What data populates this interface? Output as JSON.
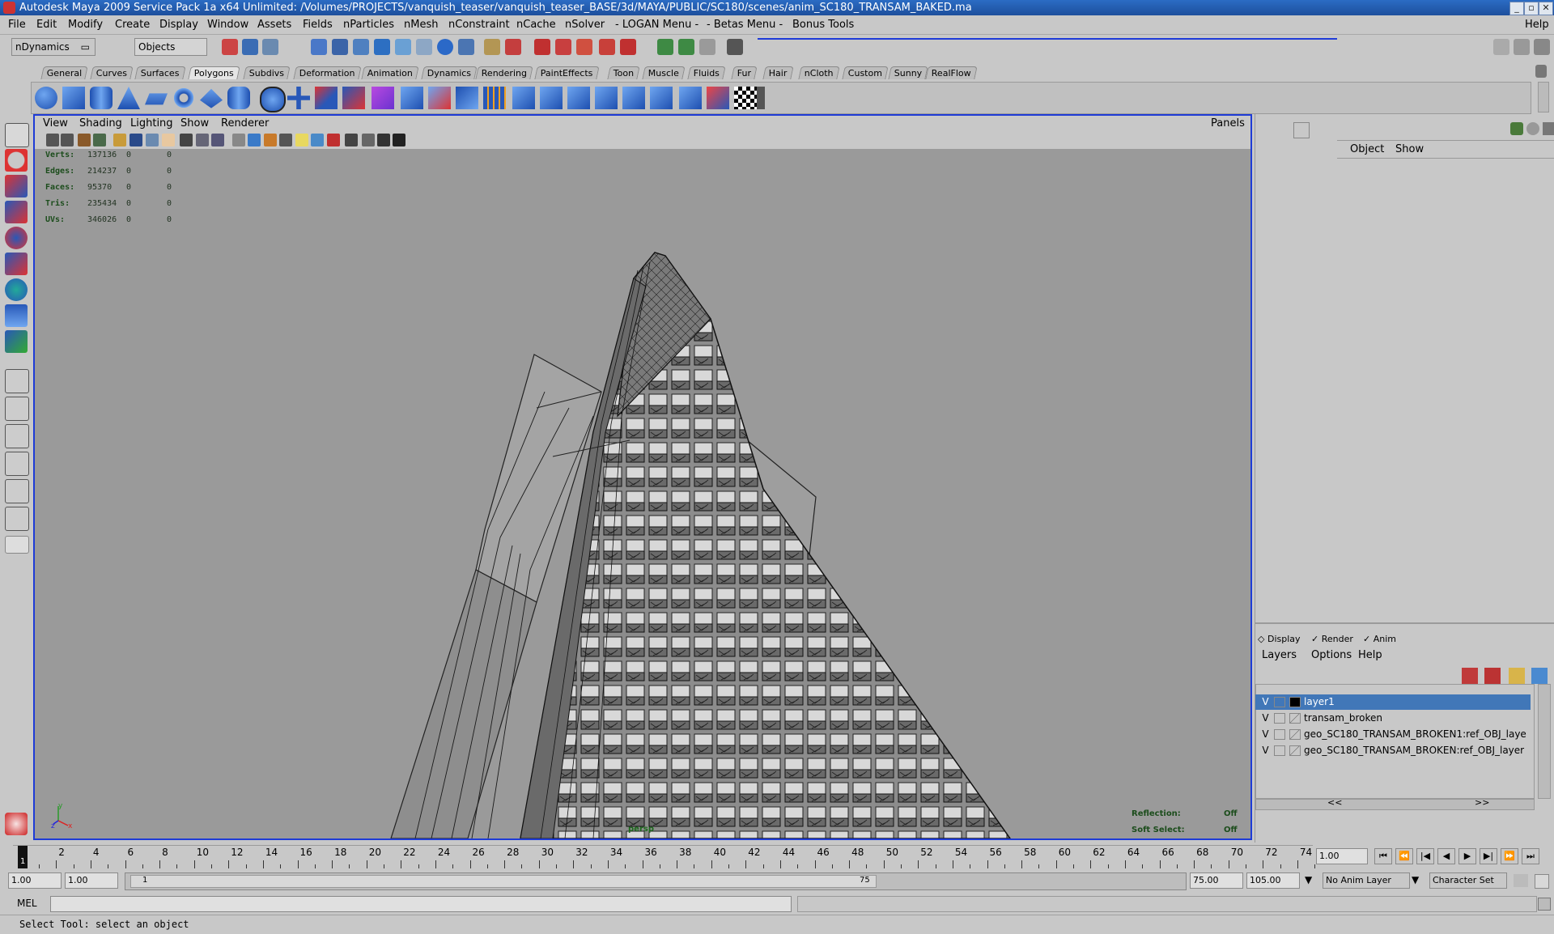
{
  "window": {
    "title": "Autodesk Maya 2009 Service Pack 1a x64 Unlimited: /Volumes/PROJECTS/vanquish_teaser/vanquish_teaser_BASE/3d/MAYA/PUBLIC/SC180/scenes/anim_SC180_TRANSAM_BAKED.ma"
  },
  "menubar": {
    "items": [
      "File",
      "Edit",
      "Modify",
      "Create",
      "Display",
      "Window",
      "Assets",
      "Fields",
      "nParticles",
      "nMesh",
      "nConstraint",
      "nCache",
      "nSolver",
      "- LOGAN Menu -",
      "- Betas Menu -",
      "Bonus Tools"
    ],
    "help": "Help"
  },
  "statusline": {
    "menuset": "nDynamics",
    "selection_mode": "Objects"
  },
  "shelf": {
    "tabs": [
      "General",
      "Curves",
      "Surfaces",
      "Polygons",
      "Subdivs",
      "Deformation",
      "Animation",
      "Dynamics",
      "Rendering",
      "PaintEffects",
      "Toon",
      "Muscle",
      "Fluids",
      "Fur",
      "Hair",
      "nCloth",
      "Custom",
      "Sunny",
      "RealFlow"
    ],
    "active_tab": "Polygons"
  },
  "viewport": {
    "menu": [
      "View",
      "Shading",
      "Lighting",
      "Show",
      "Renderer"
    ],
    "panels": "Panels",
    "camera": "persp",
    "hud": {
      "rows": [
        {
          "label": "Verts:",
          "v1": "137136",
          "v2": "0",
          "v3": "0"
        },
        {
          "label": "Edges:",
          "v1": "214237",
          "v2": "0",
          "v3": "0"
        },
        {
          "label": "Faces:",
          "v1": "95370",
          "v2": "0",
          "v3": "0"
        },
        {
          "label": "Tris:",
          "v1": "235434",
          "v2": "0",
          "v3": "0"
        },
        {
          "label": "UVs:",
          "v1": "346026",
          "v2": "0",
          "v3": "0"
        }
      ]
    },
    "reflection_label": "Reflection:",
    "reflection_value": "Off",
    "soft_select_label": "Soft Select:",
    "soft_select_value": "Off",
    "axis": {
      "x": "x",
      "y": "y",
      "z": "z"
    }
  },
  "channelbox": {
    "menu": [
      "Object",
      "Show"
    ]
  },
  "layereditor": {
    "modes": [
      "Display",
      "Render",
      "Anim"
    ],
    "menu": [
      "Layers",
      "Options",
      "Help"
    ],
    "layers": [
      {
        "v": "V",
        "name": "layer1",
        "selected": true,
        "color": "#000000"
      },
      {
        "v": "V",
        "name": "transam_broken",
        "selected": false
      },
      {
        "v": "V",
        "name": "geo_SC180_TRANSAM_BROKEN1:ref_OBJ_laye",
        "selected": false
      },
      {
        "v": "V",
        "name": "geo_SC180_TRANSAM_BROKEN:ref_OBJ_layer",
        "selected": false
      }
    ],
    "scroll_left": "<<",
    "scroll_right": ">>"
  },
  "timeline": {
    "ticks": [
      "2",
      "4",
      "6",
      "8",
      "10",
      "12",
      "14",
      "16",
      "18",
      "20",
      "22",
      "24",
      "26",
      "28",
      "30",
      "32",
      "34",
      "36",
      "38",
      "40",
      "42",
      "44",
      "46",
      "48",
      "50",
      "52",
      "54",
      "56",
      "58",
      "60",
      "62",
      "64",
      "66",
      "68",
      "70",
      "72",
      "74"
    ],
    "current_frame_marker": "1",
    "current_time": "1.00"
  },
  "range": {
    "start_time": "1.00",
    "playback_start": "1.00",
    "range_start_label": "1",
    "range_end_label": "75",
    "playback_end": "75.00",
    "end_time": "105.00",
    "anim_layer": "No Anim Layer",
    "character_set": "Character Set"
  },
  "commandline": {
    "label": "MEL"
  },
  "helpline": {
    "text": "Select Tool: select an object"
  }
}
